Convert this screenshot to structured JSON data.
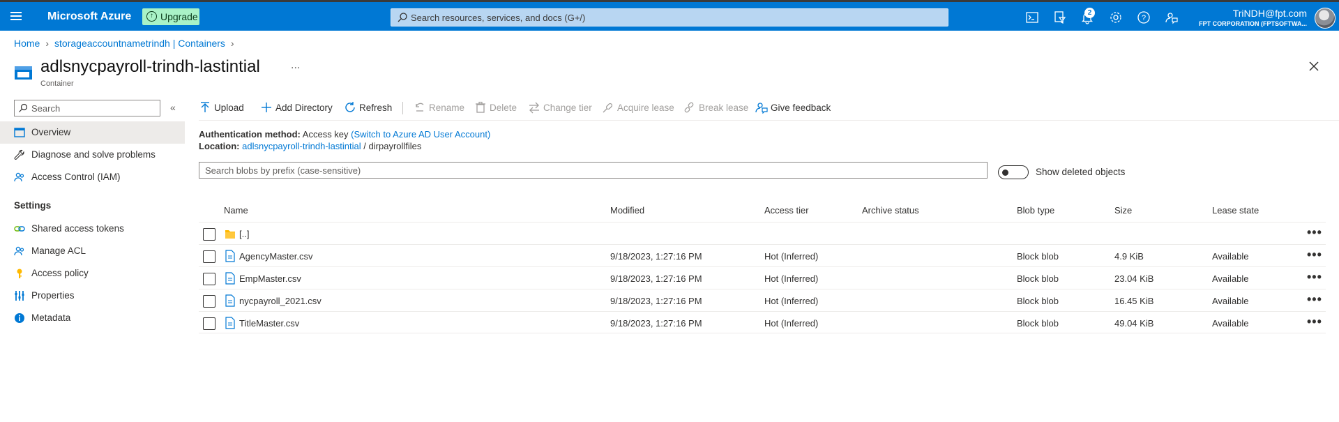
{
  "topbar": {
    "brand": "Microsoft Azure",
    "upgrade_label": "Upgrade",
    "search_placeholder": "Search resources, services, and docs (G+/)",
    "notification_count": "2",
    "user_name": "TriNDH@fpt.com",
    "user_org": "FPT CORPORATION (FPTSOFTWA...",
    "icons": [
      "cloud-shell-icon",
      "directory-filter-icon",
      "notifications-icon",
      "settings-icon",
      "help-icon",
      "feedback-icon"
    ]
  },
  "breadcrumb": {
    "home": "Home",
    "parent": "storageaccountnametrindh | Containers"
  },
  "page": {
    "title": "adlsnycpayroll-trindh-lastintial",
    "subtitle": "Container",
    "more": "..."
  },
  "sidebar": {
    "search_placeholder": "Search",
    "collapse": "«",
    "items": [
      {
        "label": "Overview",
        "icon": "container-icon"
      },
      {
        "label": "Diagnose and solve problems",
        "icon": "wrench-icon"
      },
      {
        "label": "Access Control (IAM)",
        "icon": "people-icon"
      }
    ],
    "settings_heading": "Settings",
    "settings_items": [
      {
        "label": "Shared access tokens",
        "icon": "link-icon"
      },
      {
        "label": "Manage ACL",
        "icon": "people-icon"
      },
      {
        "label": "Access policy",
        "icon": "key-icon"
      },
      {
        "label": "Properties",
        "icon": "sliders-icon"
      },
      {
        "label": "Metadata",
        "icon": "info-icon"
      }
    ]
  },
  "toolbar": {
    "upload": "Upload",
    "add_directory": "Add Directory",
    "refresh": "Refresh",
    "rename": "Rename",
    "delete": "Delete",
    "change_tier": "Change tier",
    "acquire_lease": "Acquire lease",
    "break_lease": "Break lease",
    "give_feedback": "Give feedback"
  },
  "info": {
    "auth_label": "Authentication method:",
    "auth_value": "Access key",
    "auth_link": "(Switch to Azure AD User Account)",
    "location_label": "Location:",
    "location_link": "adlsnycpayroll-trindh-lastintial",
    "location_sep": "/",
    "location_dir": "dirpayrollfiles"
  },
  "blob_search_placeholder": "Search blobs by prefix (case-sensitive)",
  "show_deleted_label": "Show deleted objects",
  "show_deleted_on": false,
  "table": {
    "columns": [
      "Name",
      "Modified",
      "Access tier",
      "Archive status",
      "Blob type",
      "Size",
      "Lease state"
    ],
    "rows": [
      {
        "name": "[..]",
        "type": "folder",
        "modified": "",
        "tier": "",
        "archive": "",
        "blob_type": "",
        "size": "",
        "lease": ""
      },
      {
        "name": "AgencyMaster.csv",
        "type": "file",
        "modified": "9/18/2023, 1:27:16 PM",
        "tier": "Hot (Inferred)",
        "archive": "",
        "blob_type": "Block blob",
        "size": "4.9 KiB",
        "lease": "Available"
      },
      {
        "name": "EmpMaster.csv",
        "type": "file",
        "modified": "9/18/2023, 1:27:16 PM",
        "tier": "Hot (Inferred)",
        "archive": "",
        "blob_type": "Block blob",
        "size": "23.04 KiB",
        "lease": "Available"
      },
      {
        "name": "nycpayroll_2021.csv",
        "type": "file",
        "modified": "9/18/2023, 1:27:16 PM",
        "tier": "Hot (Inferred)",
        "archive": "",
        "blob_type": "Block blob",
        "size": "16.45 KiB",
        "lease": "Available"
      },
      {
        "name": "TitleMaster.csv",
        "type": "file",
        "modified": "9/18/2023, 1:27:16 PM",
        "tier": "Hot (Inferred)",
        "archive": "",
        "blob_type": "Block blob",
        "size": "49.04 KiB",
        "lease": "Available"
      }
    ],
    "row_more": "•••"
  },
  "colors": {
    "azure_blue": "#0078d4",
    "upgrade_green": "#a9f2c7",
    "folder_yellow": "#ffb900",
    "disabled_text": "#a19f9d"
  }
}
